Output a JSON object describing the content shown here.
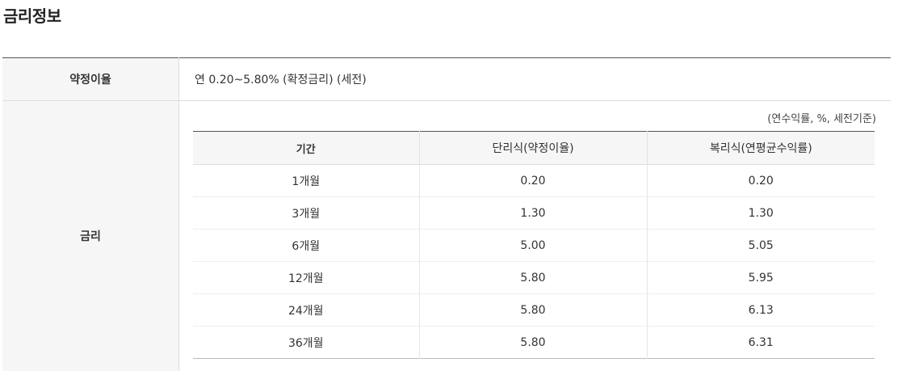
{
  "page": {
    "title": "금리정보"
  },
  "info": {
    "rate_label": "약정이율",
    "rate_value": "연 0.20~5.80% (확정금리) (세전)",
    "interest_label": "금리"
  },
  "rate_table": {
    "unit_note": "(연수익률, %, 세전기준)",
    "headers": [
      "기간",
      "단리식(약정이율)",
      "복리식(연평균수익률)"
    ],
    "rows": [
      [
        "1개월",
        "0.20",
        "0.20"
      ],
      [
        "3개월",
        "1.30",
        "1.30"
      ],
      [
        "6개월",
        "5.00",
        "5.05"
      ],
      [
        "12개월",
        "5.80",
        "5.95"
      ],
      [
        "24개월",
        "5.80",
        "6.13"
      ],
      [
        "36개월",
        "5.80",
        "6.31"
      ]
    ]
  }
}
